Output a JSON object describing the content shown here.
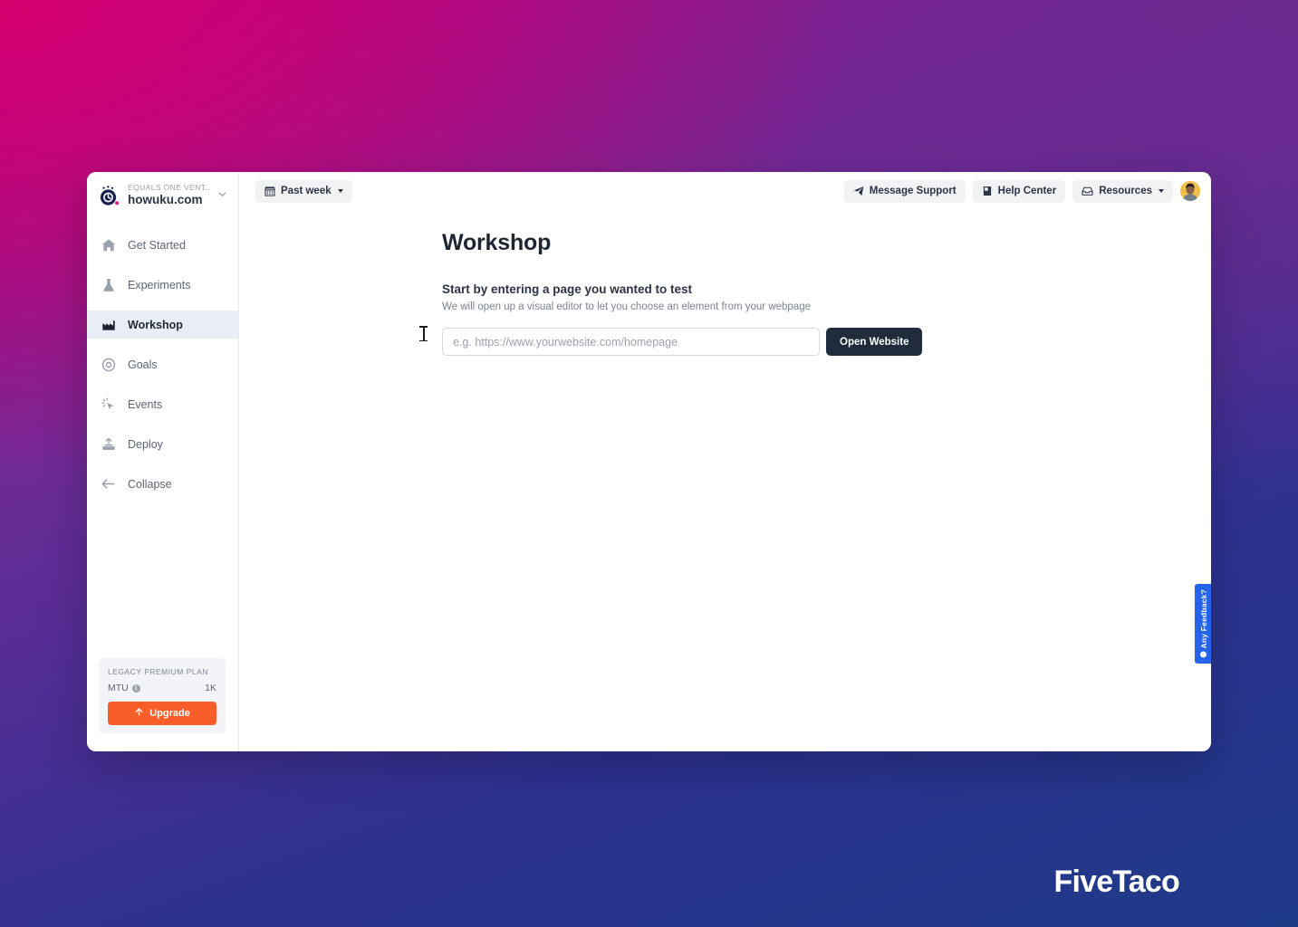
{
  "brand": {
    "org": "EQUALS ONE VENT...",
    "site": "howuku.com",
    "logo_icon": "howuku-clock-logo",
    "caret_icon": "chevron-down-icon"
  },
  "sidebar": {
    "items": [
      {
        "label": "Get Started",
        "icon": "home-icon",
        "active": false
      },
      {
        "label": "Experiments",
        "icon": "flask-icon",
        "active": false
      },
      {
        "label": "Workshop",
        "icon": "factory-icon",
        "active": true
      },
      {
        "label": "Goals",
        "icon": "target-icon",
        "active": false
      },
      {
        "label": "Events",
        "icon": "click-cursor-icon",
        "active": false
      },
      {
        "label": "Deploy",
        "icon": "deploy-upload-icon",
        "active": false
      },
      {
        "label": "Collapse",
        "icon": "arrow-left-icon",
        "active": false
      }
    ],
    "plan": {
      "title": "LEGACY PREMIUM PLAN",
      "metric_label": "MTU",
      "metric_info_icon": "info-icon",
      "metric_value": "1K",
      "upgrade_label": "Upgrade",
      "upgrade_icon": "arrow-up-icon",
      "upgrade_color": "#f95d28"
    }
  },
  "topbar": {
    "date_filter": {
      "label": "Past week",
      "icon": "calendar-icon",
      "caret_icon": "chevron-down-icon"
    },
    "message_support": {
      "label": "Message Support",
      "icon": "send-paper-plane-icon"
    },
    "help_center": {
      "label": "Help Center",
      "icon": "book-icon"
    },
    "resources": {
      "label": "Resources",
      "icon": "inbox-tray-icon",
      "caret_icon": "chevron-down-icon"
    },
    "avatar": {
      "name": "user-avatar"
    }
  },
  "main": {
    "title": "Workshop",
    "section_heading": "Start by entering a page you wanted to test",
    "section_subtext": "We will open up a visual editor to let you choose an element from your webpage",
    "url_input": {
      "value": "",
      "placeholder": "e.g. https://www.yourwebsite.com/homepage"
    },
    "open_button": {
      "label": "Open Website",
      "color": "#202b3c"
    }
  },
  "feedback_tab": {
    "label": "Any Feedback?",
    "icon": "chat-dot-icon",
    "color": "#2563eb"
  },
  "watermark": {
    "text": "FiveTaco"
  },
  "theme": {
    "bg_pink": "#c90a6e",
    "bg_purple": "#6b2a8e",
    "bg_blue": "#1f3a85",
    "active_nav_bg": "#e9edf5"
  }
}
